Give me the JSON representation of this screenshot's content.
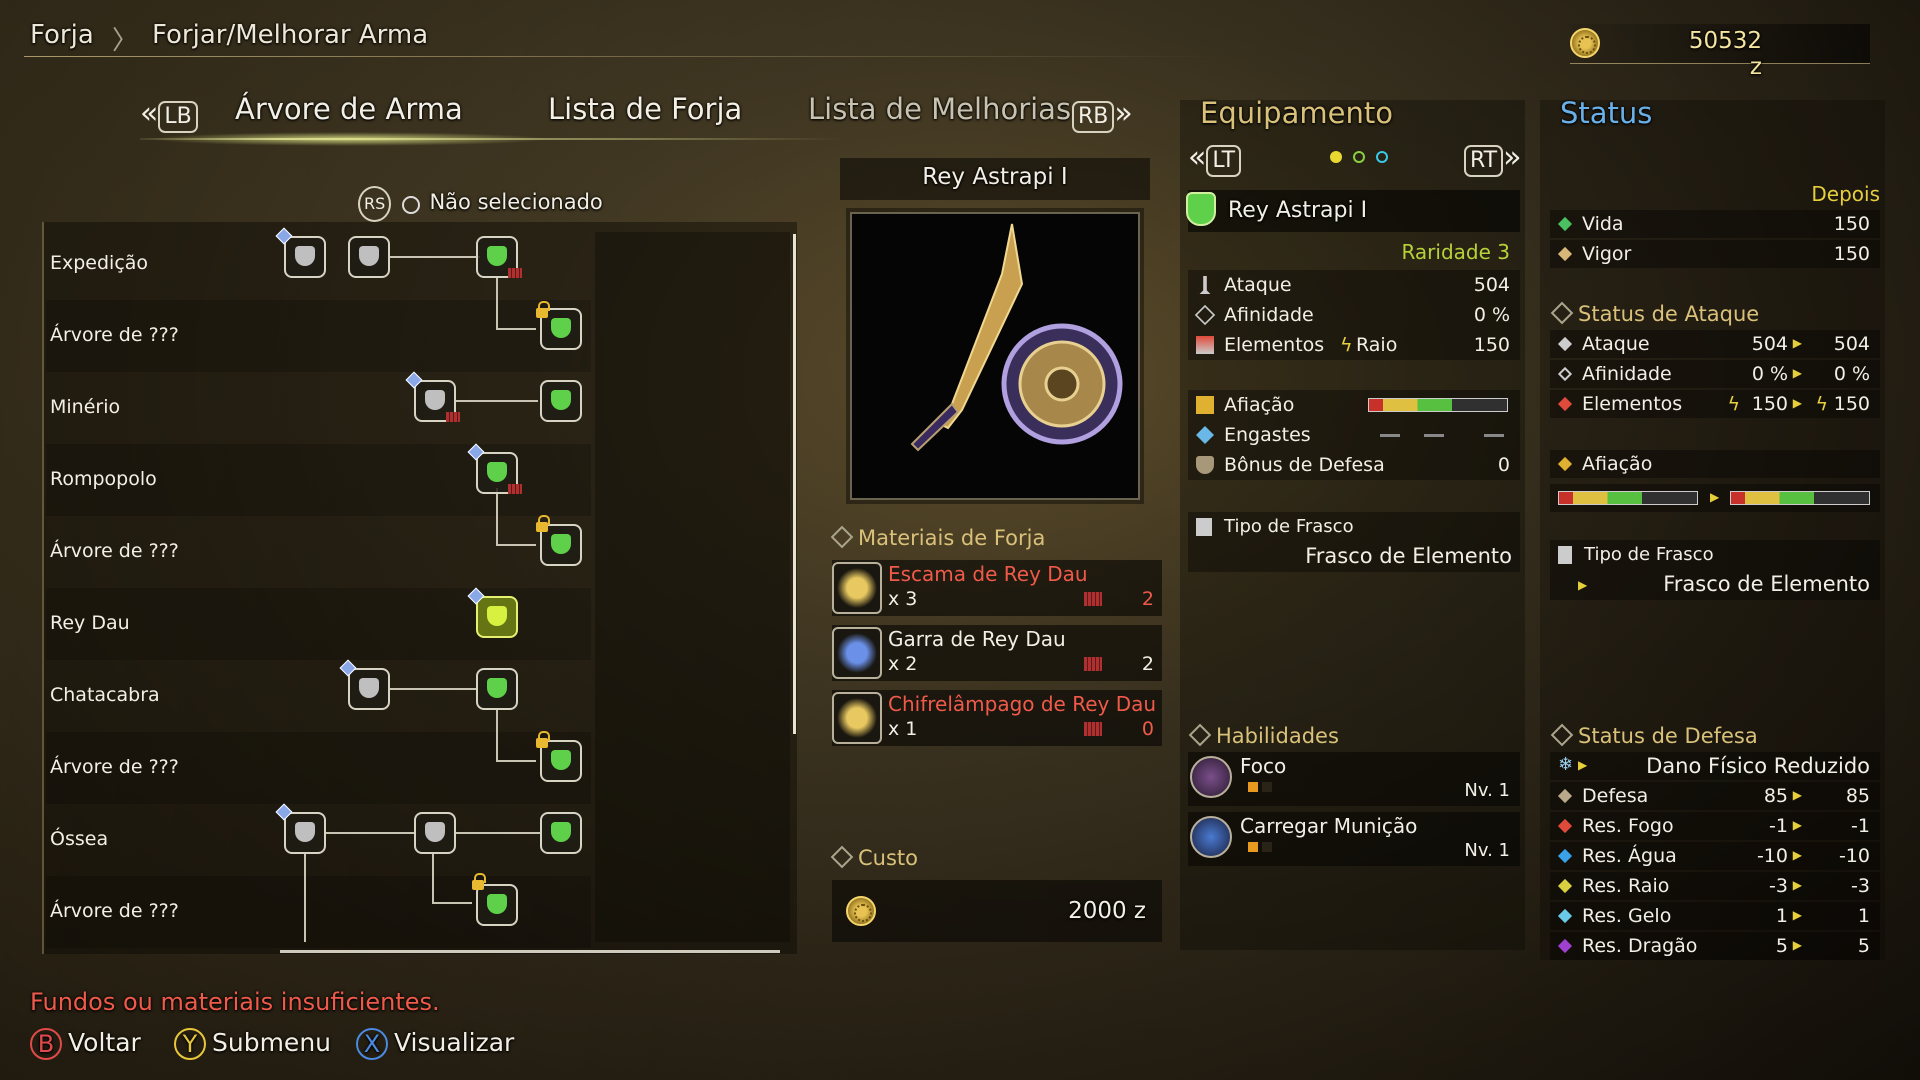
{
  "breadcrumb": {
    "root": "Forja",
    "current": "Forjar/Melhorar Arma"
  },
  "money": "50532 z",
  "tabs": {
    "prev_button": "LB",
    "next_button": "RB",
    "items": [
      "Árvore de Arma",
      "Lista de Forja",
      "Lista de Melhorias"
    ]
  },
  "filter": {
    "button": "RS",
    "label": "Não selecionado"
  },
  "tree_rows": [
    "Expedição",
    "Árvore de ???",
    "Minério",
    "Rompopolo",
    "Árvore de ???",
    "Rey Dau",
    "Chatacabra",
    "Árvore de ???",
    "Óssea",
    "Árvore de ???"
  ],
  "weapon": {
    "name": "Rey Astrapi I",
    "materials_header": "Materiais de Forja",
    "materials": [
      {
        "name": "Escama de Rey Dau",
        "qty": "x 3",
        "have": "2",
        "insufficient": true
      },
      {
        "name": "Garra de Rey Dau",
        "qty": "x 2",
        "have": "2",
        "insufficient": false
      },
      {
        "name": "Chifrelâmpago de Rey Dau",
        "qty": "x 1",
        "have": "0",
        "insufficient": true
      }
    ],
    "cost_header": "Custo",
    "cost": "2000 z"
  },
  "equipment": {
    "header": "Equipamento",
    "prev_button": "LT",
    "next_button": "RT",
    "name": "Rey Astrapi I",
    "rarity": "Raridade 3",
    "attack_label": "Ataque",
    "attack": "504",
    "affinity_label": "Afinidade",
    "affinity": "0 %",
    "elements_label": "Elementos",
    "element_type": "Raio",
    "element_value": "150",
    "sharpness_label": "Afiação",
    "slots_label": "Engastes",
    "defense_bonus_label": "Bônus de Defesa",
    "defense_bonus": "0",
    "phial_label": "Tipo de Frasco",
    "phial": "Frasco de Elemento",
    "skills_header": "Habilidades",
    "skills": [
      {
        "name": "Foco",
        "level": "Nv. 1"
      },
      {
        "name": "Carregar Munição",
        "level": "Nv. 1"
      }
    ]
  },
  "status": {
    "header": "Status",
    "after_label": "Depois",
    "health_label": "Vida",
    "health": "150",
    "stamina_label": "Vigor",
    "stamina": "150",
    "attack_header": "Status de Ataque",
    "attack_rows": [
      {
        "label": "Ataque",
        "before": "504",
        "after": "504"
      },
      {
        "label": "Afinidade",
        "before": "0 %",
        "after": "0 %"
      },
      {
        "label": "Elementos",
        "before": "150",
        "after": "150"
      }
    ],
    "sharpness_label": "Afiação",
    "phial_label": "Tipo de Frasco",
    "phial": "Frasco de Elemento",
    "defense_header": "Status de Defesa",
    "defense_effect": "Dano Físico Reduzido",
    "defense_rows": [
      {
        "label": "Defesa",
        "before": "85",
        "after": "85",
        "color": "#b8a98a"
      },
      {
        "label": "Res. Fogo",
        "before": "-1",
        "after": "-1",
        "color": "#e04a3a"
      },
      {
        "label": "Res. Água",
        "before": "-10",
        "after": "-10",
        "color": "#3aa0e8"
      },
      {
        "label": "Res. Raio",
        "before": "-3",
        "after": "-3",
        "color": "#d8d040"
      },
      {
        "label": "Res. Gelo",
        "before": "1",
        "after": "1",
        "color": "#6ac8e8"
      },
      {
        "label": "Res. Dragão",
        "before": "5",
        "after": "5",
        "color": "#a040d0"
      }
    ]
  },
  "warning": "Fundos ou materiais insuficientes.",
  "hints": [
    {
      "button": "B",
      "label": "Voltar",
      "color": "#e04a4a"
    },
    {
      "button": "Y",
      "label": "Submenu",
      "color": "#e8c83a"
    },
    {
      "button": "X",
      "label": "Visualizar",
      "color": "#4a8ae0"
    }
  ],
  "colors": {
    "accent": "#d9c17a",
    "green_text": "#b7d13a",
    "red_text": "#f05a4a",
    "status_blue": "#6ab0e8"
  }
}
